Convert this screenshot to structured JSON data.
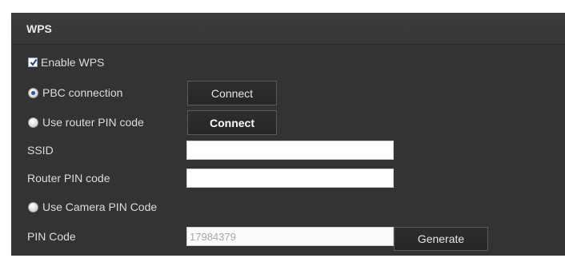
{
  "section": {
    "title": "WPS"
  },
  "enable_wps": {
    "label": "Enable WPS",
    "checked": true
  },
  "pbc": {
    "label": "PBC connection",
    "selected": true,
    "button_label": "Connect"
  },
  "router_pin": {
    "label": "Use router PIN code",
    "selected": false,
    "button_label": "Connect"
  },
  "ssid": {
    "label": "SSID",
    "value": ""
  },
  "router_pin_code": {
    "label": "Router PIN code",
    "value": ""
  },
  "camera_pin": {
    "label": "Use Camera PIN Code",
    "selected": false
  },
  "pin_code": {
    "label": "PIN Code",
    "value": "17984379",
    "button_label": "Generate"
  },
  "colors": {
    "panel_bg": "#333333",
    "header_bg": "#3a3a3a",
    "text": "#dcdcdc",
    "radio_selected": "#1e5aa8"
  }
}
